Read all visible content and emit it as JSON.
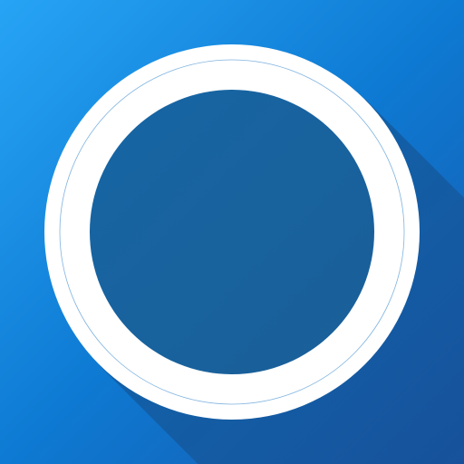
{
  "icon": {
    "symbol": "ring-icon",
    "colors": {
      "background_light": "#27A4F5",
      "background_mid": "#0E7AD3",
      "background_dark": "#1757AA",
      "shadow": "#173F6E",
      "ring": "#FFFFFF",
      "ring_guide_line": "#7FB3E0",
      "center_light": "#1665A4",
      "center_dark": "#1A5F98"
    }
  }
}
